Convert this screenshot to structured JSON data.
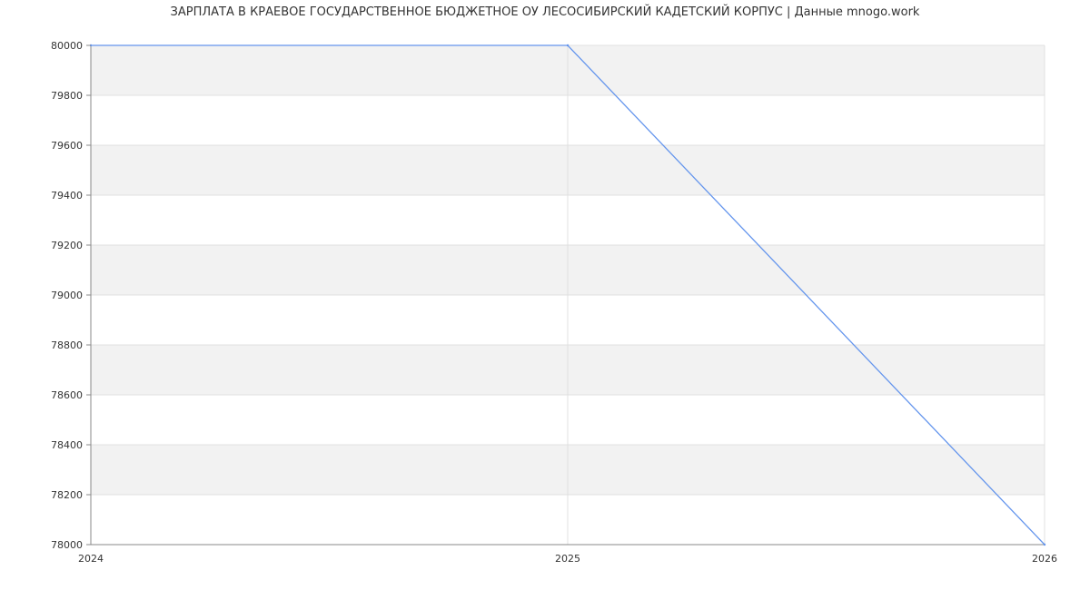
{
  "chart_data": {
    "type": "line",
    "title": "ЗАРПЛАТА В КРАЕВОЕ ГОСУДАРСТВЕННОЕ БЮДЖЕТНОЕ ОУ ЛЕСОСИБИРСКИЙ КАДЕТСКИЙ КОРПУС | Данные mnogo.work",
    "xlabel": "",
    "ylabel": "",
    "x": [
      "2024",
      "2025",
      "2026"
    ],
    "series": [
      {
        "values": [
          80000,
          80000,
          78000
        ]
      }
    ],
    "xlim": [
      2024,
      2026
    ],
    "ylim": [
      78000,
      80000
    ],
    "y_ticks": [
      "80000",
      "79800",
      "79600",
      "79400",
      "79200",
      "79000",
      "78800",
      "78600",
      "78400",
      "78200",
      "78000"
    ],
    "x_ticks": [
      "2024",
      "2025",
      "2026"
    ],
    "grid": true,
    "legend": "none",
    "colors": {
      "line": "#6495ed",
      "band": "#f2f2f2",
      "grid": "#e0e0e0",
      "axis": "#888888",
      "text": "#333333"
    }
  }
}
